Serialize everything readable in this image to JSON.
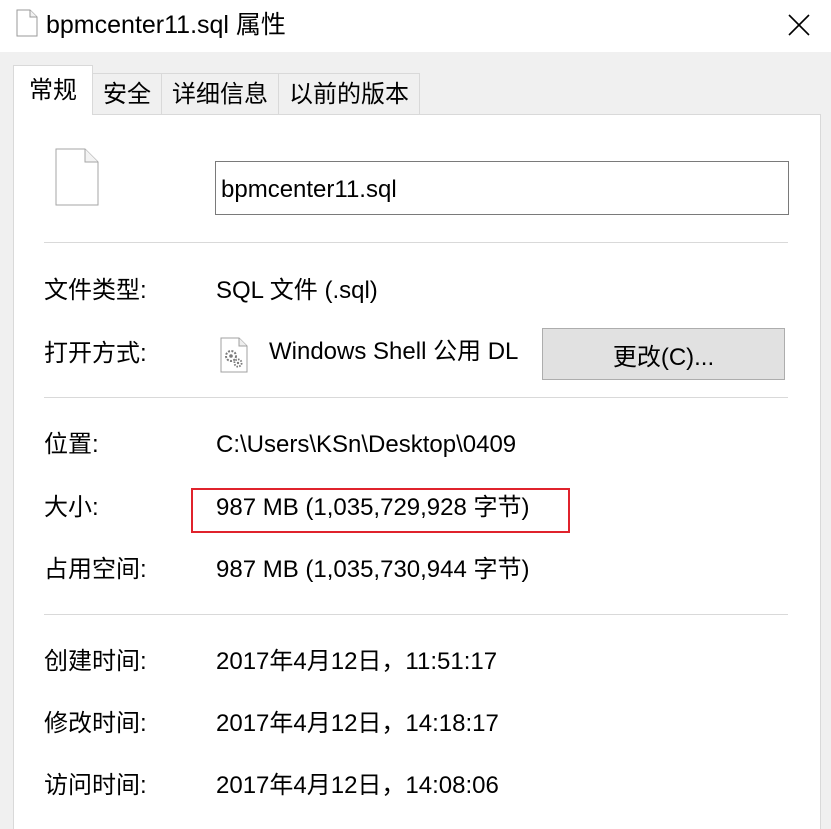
{
  "window": {
    "title": "bpmcenter11.sql 属性",
    "title_icon": "file-icon",
    "close_icon": "close-icon"
  },
  "tabs": [
    {
      "label": "常规",
      "active": true
    },
    {
      "label": "安全",
      "active": false
    },
    {
      "label": "详细信息",
      "active": false
    },
    {
      "label": "以前的版本",
      "active": false
    }
  ],
  "general": {
    "file_icon": "file-icon",
    "file_name": "bpmcenter11.sql",
    "type_label": "文件类型:",
    "type_value": "SQL 文件 (.sql)",
    "opens_with_label": "打开方式:",
    "opens_with_icon": "gear-document-icon",
    "opens_with_value": "Windows Shell 公用 DL",
    "change_button": "更改(C)...",
    "location_label": "位置:",
    "location_value": "C:\\Users\\KSn\\Desktop\\0409",
    "size_label": "大小:",
    "size_value": "987 MB (1,035,729,928 字节)",
    "size_on_disk_label": "占用空间:",
    "size_on_disk_value": "987 MB (1,035,730,944 字节)",
    "created_label": "创建时间:",
    "created_value": "2017年4月12日，11:51:17",
    "modified_label": "修改时间:",
    "modified_value": "2017年4月12日，14:18:17",
    "accessed_label": "访问时间:",
    "accessed_value": "2017年4月12日，14:08:06"
  },
  "colors": {
    "highlight": "#e0232c",
    "button_bg": "#e1e1e1",
    "divider": "#d9d9d9"
  }
}
